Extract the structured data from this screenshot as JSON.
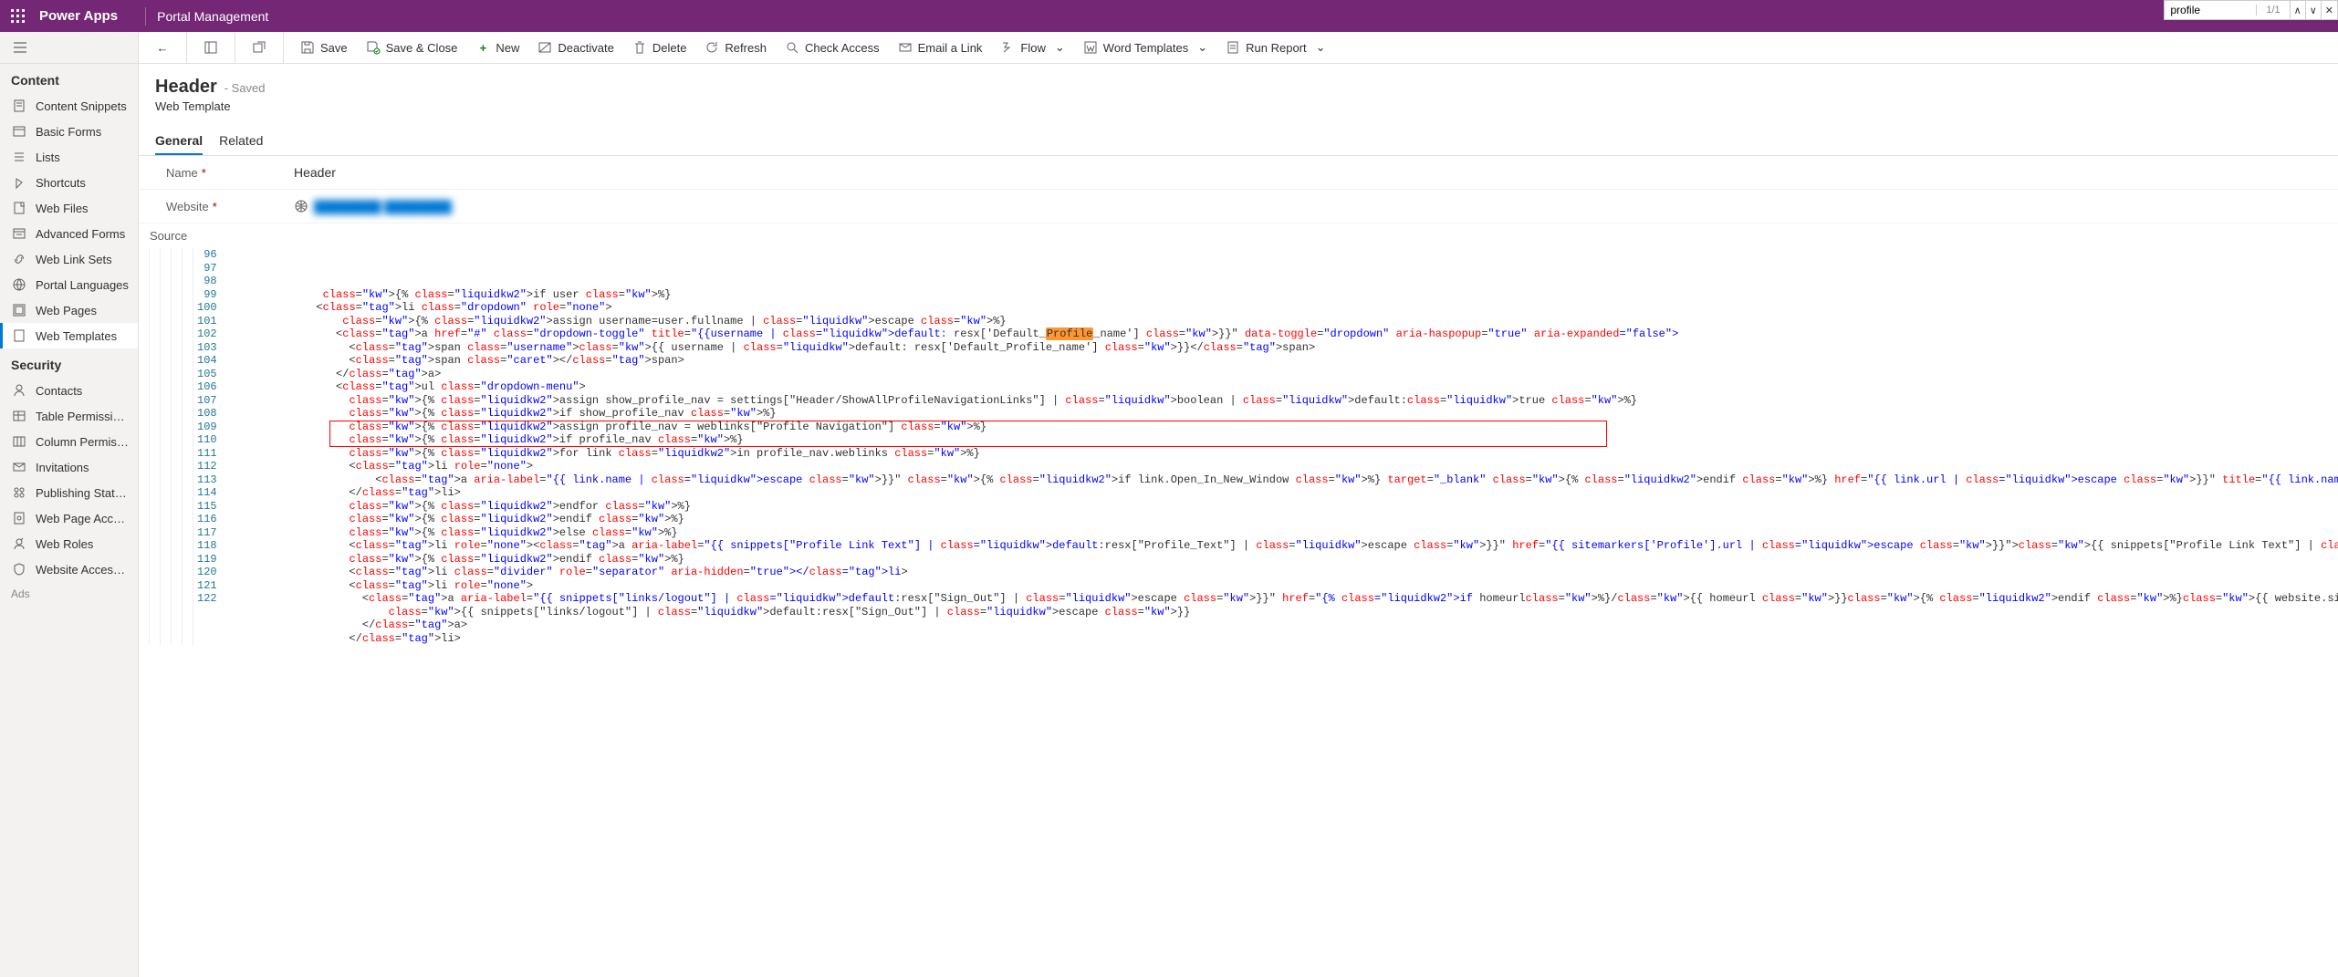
{
  "topbar": {
    "appname": "Power Apps",
    "subapp": "Portal Management"
  },
  "findbar": {
    "value": "profile",
    "count": "1/1"
  },
  "commandbar": {
    "save": "Save",
    "saveclose": "Save & Close",
    "new": "New",
    "deactivate": "Deactivate",
    "delete": "Delete",
    "refresh": "Refresh",
    "checkaccess": "Check Access",
    "emaillink": "Email a Link",
    "flow": "Flow",
    "wordtemplates": "Word Templates",
    "runreport": "Run Report"
  },
  "leftnav": {
    "contentHeader": "Content",
    "contentItems": [
      "Content Snippets",
      "Basic Forms",
      "Lists",
      "Shortcuts",
      "Web Files",
      "Advanced Forms",
      "Web Link Sets",
      "Portal Languages",
      "Web Pages",
      "Web Templates"
    ],
    "securityHeader": "Security",
    "securityItems": [
      "Contacts",
      "Table Permissions",
      "Column Permissio...",
      "Invitations",
      "Publishing State T...",
      "Web Page Access ...",
      "Web Roles",
      "Website Access P..."
    ],
    "ads": "Ads"
  },
  "page": {
    "title": "Header",
    "status": "- Saved",
    "subtitle": "Web Template",
    "tabs": [
      "General",
      "Related"
    ],
    "nameLabel": "Name",
    "nameValue": "Header",
    "websiteLabel": "Website",
    "websiteValue": "████████  ████████",
    "sourceLabel": "Source"
  },
  "code": {
    "startLine": 96,
    "lines": [
      "               {% if user %}",
      "              <li class=\"dropdown\" role=\"none\">",
      "                  {% assign username=user.fullname | escape %}",
      "                 <a href=\"#\" class=\"dropdown-toggle\" title=\"{{username | default: resx['Default_Profile_name'] }}\" data-toggle=\"dropdown\" aria-haspopup=\"true\" aria-expanded=\"false\">",
      "                   <span class=\"username\">{{ username | default: resx['Default_Profile_name'] }}</span>",
      "                   <span class=\"caret\"></span>",
      "                 </a>",
      "                 <ul class=\"dropdown-menu\">",
      "                   {% assign show_profile_nav = settings[\"Header/ShowAllProfileNavigationLinks\"] | boolean | default:true %}",
      "                   {% if show_profile_nav %}",
      "                   {% assign profile_nav = weblinks[\"Profile Navigation\"] %}",
      "                   {% if profile_nav %}",
      "                   {% for link in profile_nav.weblinks %}",
      "                   <li role=\"none\">",
      "                       <a aria-label=\"{{ link.name | escape }}\" {% if link.Open_In_New_Window %} target=\"_blank\" {% endif %} href=\"{{ link.url | escape }}\" title=\"{{ link.name | escape }}\">{{ link.name | escape }}</a>",
      "                   </li>",
      "                   {% endfor %}",
      "                   {% endif %}",
      "                   {% else %}",
      "                   <li role=\"none\"><a aria-label=\"{{ snippets[\"Profile Link Text\"] | default:resx[\"Profile_Text\"] | escape }}\" href=\"{{ sitemarkers['Profile'].url | escape }}\">{{ snippets[\"Profile Link Text\"] | default:r",
      "                   {% endif %}",
      "                   <li class=\"divider\" role=\"separator\" aria-hidden=\"true\"></li>",
      "                   <li role=\"none\">",
      "                     <a aria-label=\"{{ snippets[\"links/logout\"] | default:resx[\"Sign_Out\"] | escape }}\" href=\"{% if homeurl%}/{{ homeurl }}{% endif %}{{ website.sign_out_url_substitution }}\" title=\"{{ snippets[\"links/lo",
      "                         {{ snippets[\"links/logout\"] | default:resx[\"Sign_Out\"] | escape }}",
      "                     </a>",
      "                   </li>"
    ]
  }
}
